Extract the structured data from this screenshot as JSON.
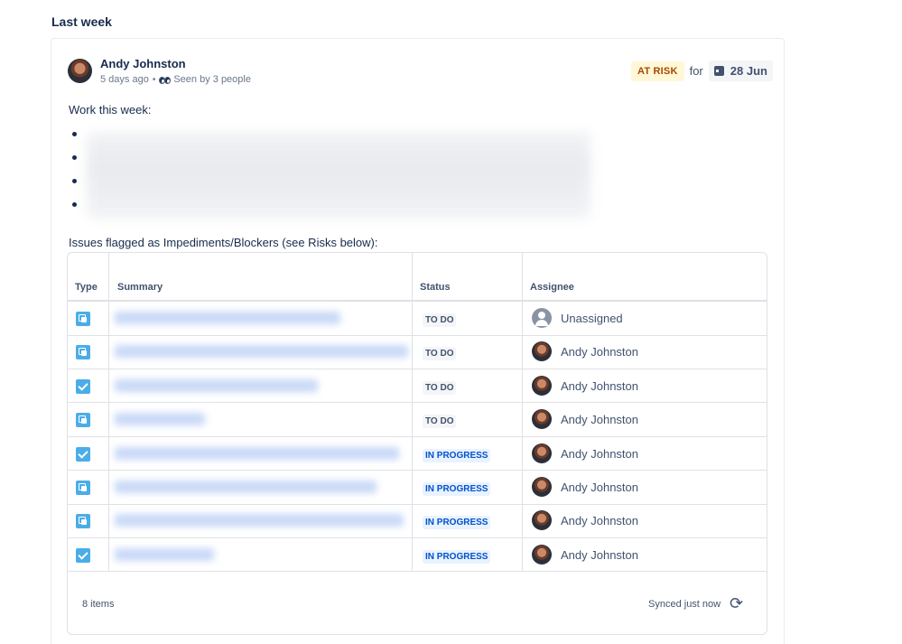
{
  "section": {
    "heading": "Last week"
  },
  "update": {
    "author": "Andy Johnston",
    "time_ago": "5 days ago",
    "separator": "•",
    "seen_by": "Seen by 3 people",
    "status_badge": "AT RISK",
    "for_label": "for",
    "target_date": "28 Jun",
    "work_label": "Work this week:",
    "bullet_count": 4,
    "issues_label": "Issues flagged as Impediments/Blockers (see Risks below):"
  },
  "table": {
    "headers": {
      "type": "Type",
      "summary": "Summary",
      "status": "Status",
      "assignee": "Assignee"
    },
    "rows": [
      {
        "type_icon": "subtask-icon",
        "status": "TO DO",
        "status_kind": "todo",
        "assignee": "Unassigned",
        "summary_blur": 0.5
      },
      {
        "type_icon": "subtask-icon",
        "status": "TO DO",
        "status_kind": "todo",
        "assignee": "Andy Johnston",
        "summary_blur": 0.65
      },
      {
        "type_icon": "task-icon",
        "status": "TO DO",
        "status_kind": "todo",
        "assignee": "Andy Johnston",
        "summary_blur": 0.45
      },
      {
        "type_icon": "subtask-icon",
        "status": "TO DO",
        "status_kind": "todo",
        "assignee": "Andy Johnston",
        "summary_blur": 0.2
      },
      {
        "type_icon": "task-icon",
        "status": "IN PROGRESS",
        "status_kind": "prog",
        "assignee": "Andy Johnston",
        "summary_blur": 0.63
      },
      {
        "type_icon": "subtask-icon",
        "status": "IN PROGRESS",
        "status_kind": "prog",
        "assignee": "Andy Johnston",
        "summary_blur": 0.58
      },
      {
        "type_icon": "subtask-icon",
        "status": "IN PROGRESS",
        "status_kind": "prog",
        "assignee": "Andy Johnston",
        "summary_blur": 0.64
      },
      {
        "type_icon": "task-icon",
        "status": "IN PROGRESS",
        "status_kind": "prog",
        "assignee": "Andy Johnston",
        "summary_blur": 0.22
      }
    ],
    "footer": {
      "item_count": "8 items",
      "synced": "Synced just now"
    }
  },
  "colors": {
    "at_risk_bg": "#fff7d6",
    "at_risk_text": "#a54800",
    "in_progress_text": "#0052cc",
    "type_icon": "#4bade8"
  }
}
